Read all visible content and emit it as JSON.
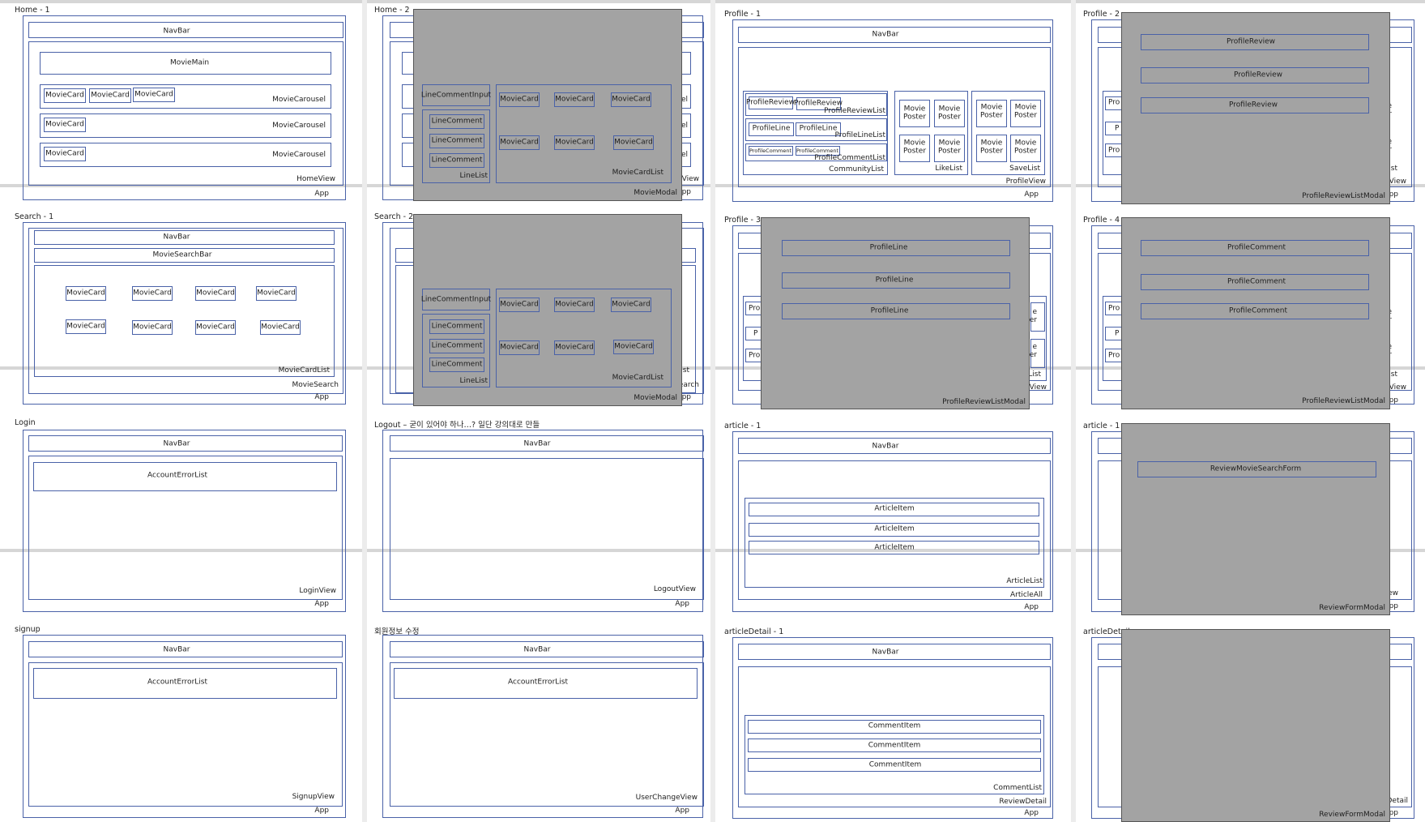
{
  "colors": {
    "box_border": "#4a62a8",
    "modal_fill": "#a3a3a3",
    "separator": "#d6d6d6"
  },
  "panels": {
    "home1": {
      "title": "Home - 1",
      "navbar": "NavBar",
      "movie_main": "MovieMain",
      "movie_card": "MovieCard",
      "carousel": "MovieCarousel",
      "view": "HomeView",
      "app": "App"
    },
    "home2": {
      "title": "Home - 2",
      "input": "LineCommentInput",
      "line_comment": "LineComment",
      "line_list": "LineList",
      "movie_card": "MovieCard",
      "card_list": "MovieCardList",
      "modal": "MovieModal",
      "peek_el": "el",
      "peek_view": "View",
      "peek_app": "pp"
    },
    "profile1": {
      "title": "Profile - 1",
      "navbar": "NavBar",
      "profile_review": "ProfileReview",
      "review_list": "ProfileReviewList",
      "profile_line": "ProfileLine",
      "line_list": "ProfileLineList",
      "profile_comment": "ProfileComment",
      "comment_list": "ProfileCommentList",
      "community_list": "CommunityList",
      "poster_a": "Movie",
      "poster_b": "Poster",
      "like_list": "LikeList",
      "save_list": "SaveList",
      "view": "ProfileView",
      "app": "App"
    },
    "profile2": {
      "title": "Profile - 2",
      "item": "ProfileReview",
      "modal": "ProfileReviewListModal",
      "peek_pro": "Pro",
      "peek_p": "P",
      "peek_e": "e",
      "peek_er": "er",
      "peek_list": "List",
      "peek_view": "View",
      "peek_app": "pp"
    },
    "search1": {
      "title": "Search - 1",
      "navbar": "NavBar",
      "search_bar": "MovieSearchBar",
      "movie_card": "MovieCard",
      "card_list": "MovieCardList",
      "view": "MovieSearch",
      "app": "App"
    },
    "search2": {
      "title": "Search - 2",
      "input": "LineCommentInput",
      "line_comment": "LineComment",
      "line_list": "LineList",
      "movie_card": "MovieCard",
      "card_list": "MovieCardList",
      "modal": "MovieModal",
      "peek_list": "ist",
      "peek_search": "earch",
      "peek_app": "pp"
    },
    "profile3": {
      "title": "Profile - 3",
      "item": "ProfileLine",
      "modal": "ProfileReviewListModal",
      "peek_pro": "Pro",
      "peek_p": "P",
      "peek_e": "e",
      "peek_er": "er",
      "peek_list": "List",
      "peek_view": "View"
    },
    "profile4": {
      "title": "Profile - 4",
      "item": "ProfileComment",
      "modal": "ProfileReviewListModal",
      "peek_pro": "Pro",
      "peek_p": "P",
      "peek_e": "e",
      "peek_er": "er",
      "peek_list": "List",
      "peek_view": "View",
      "peek_app": "pp"
    },
    "login": {
      "title": "Login",
      "navbar": "NavBar",
      "error_list": "AccountErrorList",
      "view": "LoginView",
      "app": "App"
    },
    "logout": {
      "title": "Logout – 굳이 있어야 하나…? 일단 강의대로 만들",
      "navbar": "NavBar",
      "view": "LogoutView",
      "app": "App"
    },
    "article1": {
      "title": "article - 1",
      "navbar": "NavBar",
      "item": "ArticleItem",
      "list": "ArticleList",
      "view": "ArticleAll",
      "app": "App"
    },
    "article1b": {
      "title": "article - 1",
      "form": "ReviewMovieSearchForm",
      "modal": "ReviewFormModal",
      "peek_ew": "ew",
      "peek_app": "pp"
    },
    "signup": {
      "title": "signup",
      "navbar": "NavBar",
      "error_list": "AccountErrorList",
      "view": "SignupView",
      "app": "App"
    },
    "userchange": {
      "title": "회원정보 수정",
      "navbar": "NavBar",
      "error_list": "AccountErrorList",
      "view": "UserChangeView",
      "app": "App"
    },
    "articledetail1": {
      "title": "articleDetail - 1",
      "navbar": "NavBar",
      "item": "CommentItem",
      "list": "CommentList",
      "view": "ReviewDetail",
      "app": "App"
    },
    "articledetail2": {
      "title": "articleDetail",
      "modal": "ReviewFormModal",
      "peek_detail": "Detail",
      "peek_app": "pp"
    }
  }
}
